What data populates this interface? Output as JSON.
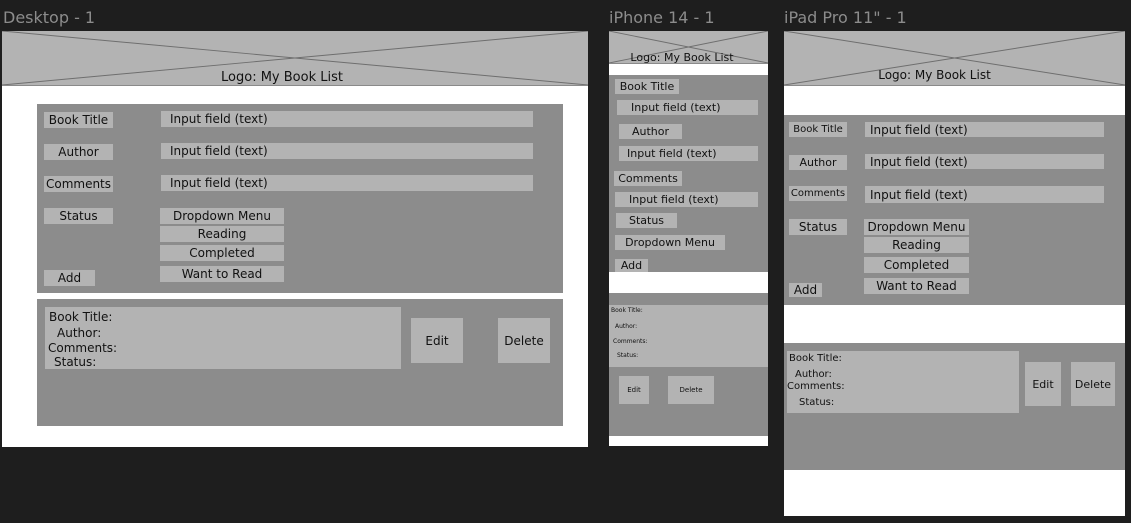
{
  "frames": {
    "desktop": {
      "label": "Desktop - 1"
    },
    "iphone": {
      "label": "iPhone 14 - 1"
    },
    "ipad": {
      "label": "iPad Pro 11\" - 1"
    }
  },
  "header": {
    "logo_text": "Logo: My Book List"
  },
  "form": {
    "book_title_label": "Book Title",
    "author_label": "Author",
    "comments_label": "Comments",
    "status_label": "Status",
    "input_placeholder": "Input field (text)",
    "dropdown_label": "Dropdown Menu",
    "options": [
      "Reading",
      "Completed",
      "Want to Read"
    ],
    "add_label": "Add"
  },
  "list_item": {
    "book_title": "Book Title:",
    "author": "Author:",
    "comments": "Comments:",
    "status": "Status:"
  },
  "actions": {
    "edit_label": "Edit",
    "delete_label": "Delete"
  },
  "colors": {
    "canvas": "#1e1e1e",
    "frame": "#ffffff",
    "panel": "#8c8c8c",
    "element": "#b3b3b3",
    "label_text": "#8c8c8c"
  }
}
